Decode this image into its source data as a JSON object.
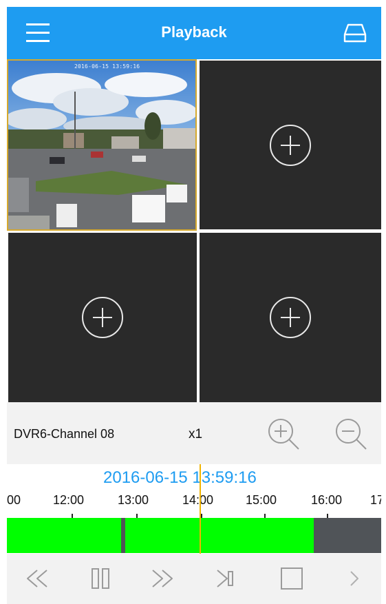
{
  "header": {
    "title": "Playback",
    "menu_icon": "hamburger-menu-icon",
    "storage_icon": "hard-drive-icon"
  },
  "grid": {
    "tiles": [
      {
        "state": "video",
        "camera_stamp": "2016-06-15 13:59:16"
      },
      {
        "state": "empty",
        "icon": "add-channel-icon"
      },
      {
        "state": "empty",
        "icon": "add-channel-icon"
      },
      {
        "state": "empty",
        "icon": "add-channel-icon"
      }
    ]
  },
  "controls": {
    "channel_name": "DVR6-Channel 08",
    "speed": "x1",
    "zoom_in_icon": "zoom-in-icon",
    "zoom_out_icon": "zoom-out-icon"
  },
  "timeline": {
    "current_time": "2016-06-15 13:59:16",
    "tick_labels": [
      "00",
      "12:00",
      "13:00",
      "14:00",
      "15:00",
      "16:00",
      "17"
    ],
    "colors": {
      "recorded": "#00ff00",
      "no_record": "#505458",
      "cursor": "#f0b400",
      "accent": "#1e9cf1"
    }
  },
  "playback_bar": {
    "buttons": [
      {
        "name": "rewind-button",
        "icon": "rewind-icon"
      },
      {
        "name": "pause-button",
        "icon": "pause-icon"
      },
      {
        "name": "fast-forward-button",
        "icon": "fast-forward-icon"
      },
      {
        "name": "step-frame-button",
        "icon": "step-forward-icon"
      },
      {
        "name": "stop-button",
        "icon": "stop-icon"
      },
      {
        "name": "next-button",
        "icon": "chevron-right-icon"
      }
    ]
  }
}
